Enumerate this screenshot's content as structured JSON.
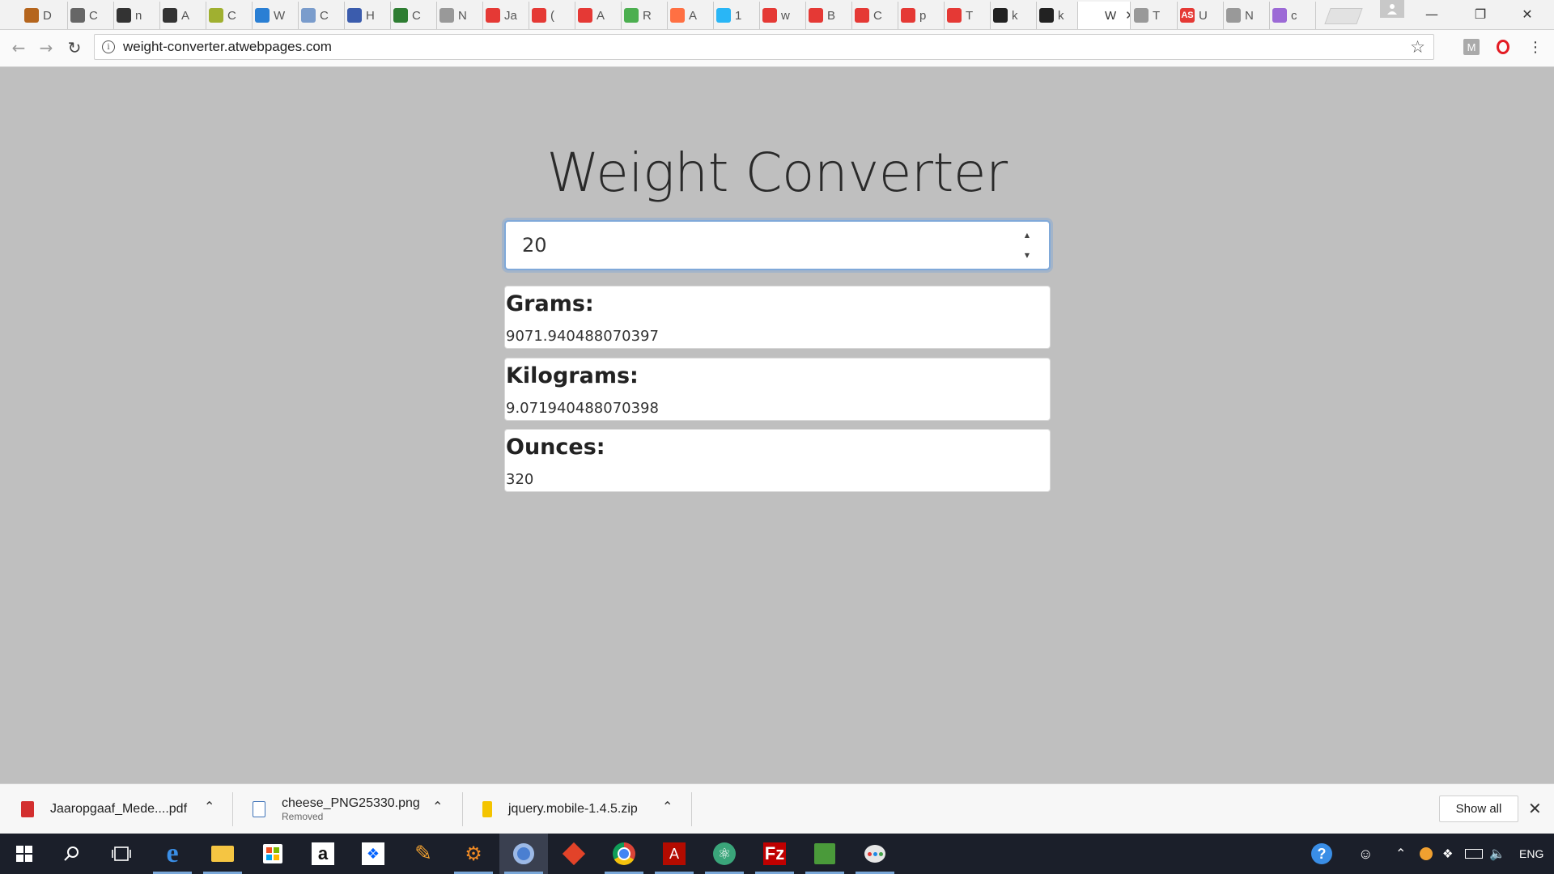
{
  "browser": {
    "tabs": [
      {
        "letter": "D",
        "color": "#b5651d"
      },
      {
        "letter": "C",
        "color": "#666666"
      },
      {
        "letter": "n",
        "color": "#333333"
      },
      {
        "letter": "A",
        "color": "#333333"
      },
      {
        "letter": "C",
        "color": "#a0b030"
      },
      {
        "letter": "W",
        "color": "#2a7fd4"
      },
      {
        "letter": "C",
        "color": "#7a9ccc"
      },
      {
        "letter": "H",
        "color": "#3b5cad"
      },
      {
        "letter": "C",
        "color": "#2e7d32"
      },
      {
        "letter": "N",
        "color": "#999999"
      },
      {
        "letter": "Ja",
        "color": "#e53935"
      },
      {
        "letter": "(",
        "color": "#e53935"
      },
      {
        "letter": "A",
        "color": "#e53935"
      },
      {
        "letter": "R",
        "color": "#4caf50"
      },
      {
        "letter": "A",
        "color": "#ff7043"
      },
      {
        "letter": "1",
        "color": "#29b6f6"
      },
      {
        "letter": "w",
        "color": "#e53935"
      },
      {
        "letter": "B",
        "color": "#e53935"
      },
      {
        "letter": "C",
        "color": "#e53935"
      },
      {
        "letter": "p",
        "color": "#e53935"
      },
      {
        "letter": "T",
        "color": "#e53935"
      },
      {
        "letter": "k",
        "color": "#222222"
      },
      {
        "letter": "k",
        "color": "#222222"
      },
      {
        "letter": "W",
        "color": "#ffffff",
        "active": true
      },
      {
        "letter": "T",
        "color": "#999999"
      },
      {
        "letter": "U",
        "color": "#e53935",
        "text": "AS"
      },
      {
        "letter": "N",
        "color": "#999999"
      },
      {
        "letter": "c",
        "color": "#9c6ad6"
      }
    ],
    "url": "weight-converter.atwebpages.com"
  },
  "converter": {
    "title": "Weight Converter",
    "input_value": "20",
    "results": [
      {
        "label": "Grams:",
        "value": "9071.940488070397"
      },
      {
        "label": "Kilograms:",
        "value": "9.071940488070398"
      },
      {
        "label": "Ounces:",
        "value": "320"
      }
    ]
  },
  "downloads": {
    "items": [
      {
        "name": "Jaaropgaaf_Mede....pdf",
        "sub": "",
        "icon_color": "#d32f2f"
      },
      {
        "name": "cheese_PNG25330.png",
        "sub": "Removed",
        "icon_color": "#3f73b8"
      },
      {
        "name": "jquery.mobile-1.4.5.zip",
        "sub": "",
        "icon_color": "#e0b000"
      }
    ],
    "show_all": "Show all"
  },
  "taskbar": {
    "language": "ENG"
  }
}
